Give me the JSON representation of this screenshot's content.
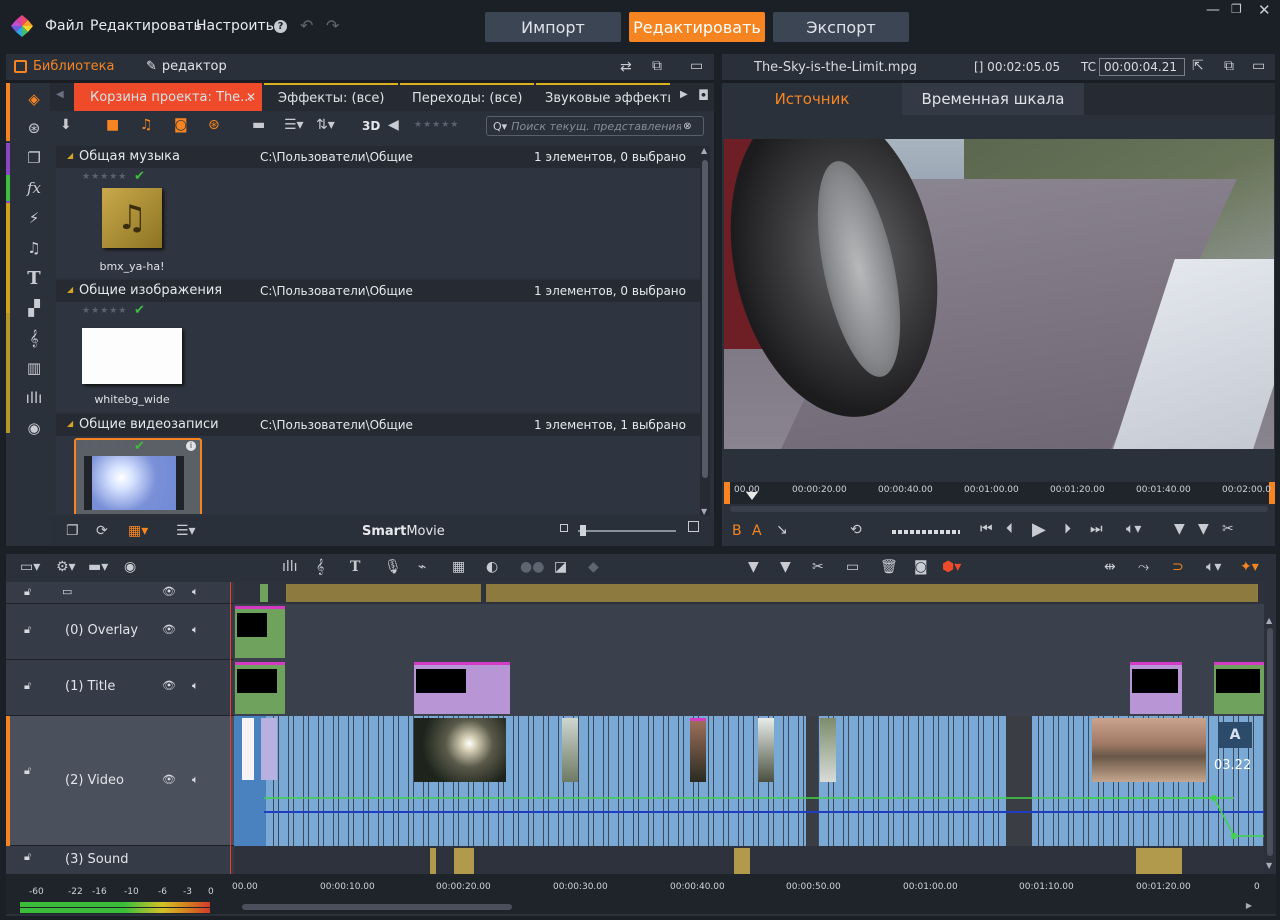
{
  "menu": {
    "file": "Файл",
    "edit": "Редактировать",
    "settings": "Настроить",
    "help": "?"
  },
  "modes": {
    "import": "Импорт",
    "edit": "Редактировать",
    "export": "Экспорт"
  },
  "library": {
    "tab_library": "Библиотека",
    "tab_editor": "редактор",
    "subtabs": [
      "Корзина проекта: The...",
      "Эффекты: (все)",
      "Переходы: (все)",
      "Звуковые эффекты"
    ],
    "btn_3d": "3D",
    "search_placeholder": "Поиск текущ. представления",
    "sections": [
      {
        "title": "Общая музыка",
        "path": "C:\\Пользователи\\Общие",
        "count": "1 элементов, 0 выбрано",
        "item": "bmx_ya-ha!"
      },
      {
        "title": "Общие изображения",
        "path": "C:\\Пользователи\\Общие",
        "count": "1 элементов, 0 выбрано",
        "item": "whitebg_wide"
      },
      {
        "title": "Общие видеозаписи",
        "path": "C:\\Пользователи\\Общие",
        "count": "1 элементов, 1 выбрано",
        "item": ""
      }
    ],
    "smartmovie_bold": "Smart",
    "smartmovie_rest": "Movie"
  },
  "preview": {
    "filename": "The-Sky-is-the-Limit.mpg",
    "duration": "[] 00:02:05.05",
    "tc_label": "TC",
    "tc_value": "00:00:04.21",
    "tab_source": "Источник",
    "tab_timeline": "Временная шкала",
    "ruler": [
      "00.00",
      "00:00:20.00",
      "00:00:40.00",
      "00:01:00.00",
      "00:01:20.00",
      "00:01:40.00",
      "00:02:00.0"
    ],
    "btn_b": "B",
    "btn_a": "A"
  },
  "timeline": {
    "tracks": [
      {
        "name": ""
      },
      {
        "name": "(0) Overlay"
      },
      {
        "name": "(1) Title"
      },
      {
        "name": "(2) Video"
      },
      {
        "name": "(3) Sound"
      }
    ],
    "clip_duration": "03.22",
    "ruler": [
      "00.00",
      "00:00:10.00",
      "00:00:20.00",
      "00:00:30.00",
      "00:00:40.00",
      "00:00:50.00",
      "00:01:00.00",
      "00:01:10.00",
      "00:01:20.00",
      "0"
    ],
    "meter": [
      "-60",
      "-22",
      "-16",
      "-10",
      "-6",
      "-3",
      "0"
    ]
  },
  "colors": {
    "accent": "#f68521",
    "video_clip": "#7aa9d5",
    "audio_clip": "#b19a4b",
    "title_clip": "#b896d6",
    "overlay_clip": "#6fa35d"
  }
}
